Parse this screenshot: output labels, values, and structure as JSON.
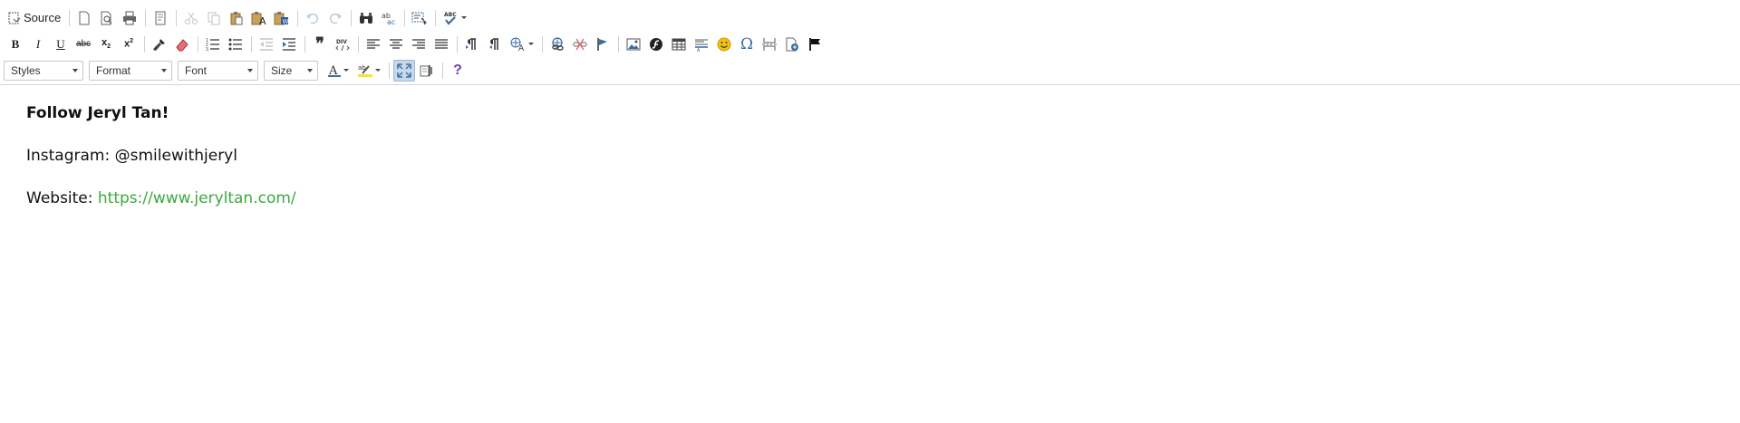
{
  "toolbar": {
    "source_label": "Source",
    "styles_label": "Styles",
    "format_label": "Format",
    "font_label": "Font",
    "size_label": "Size",
    "bold_label": "B",
    "italic_label": "I",
    "underline_label": "U",
    "strike_label": "abc",
    "blockquote_label": "❞",
    "help_label": "?",
    "omega_label": "Ω"
  },
  "content": {
    "heading": "Follow Jeryl Tan!",
    "instagram_line": "Instagram: @smilewithjeryl",
    "website_prefix": "Website: ",
    "website_link": "https://www.jeryltan.com/"
  },
  "colors": {
    "link": "#3ea83e",
    "icon_blue": "#3a6ea5",
    "emoji_yellow": "#f4c20d",
    "help_purple": "#6d3fa8"
  }
}
